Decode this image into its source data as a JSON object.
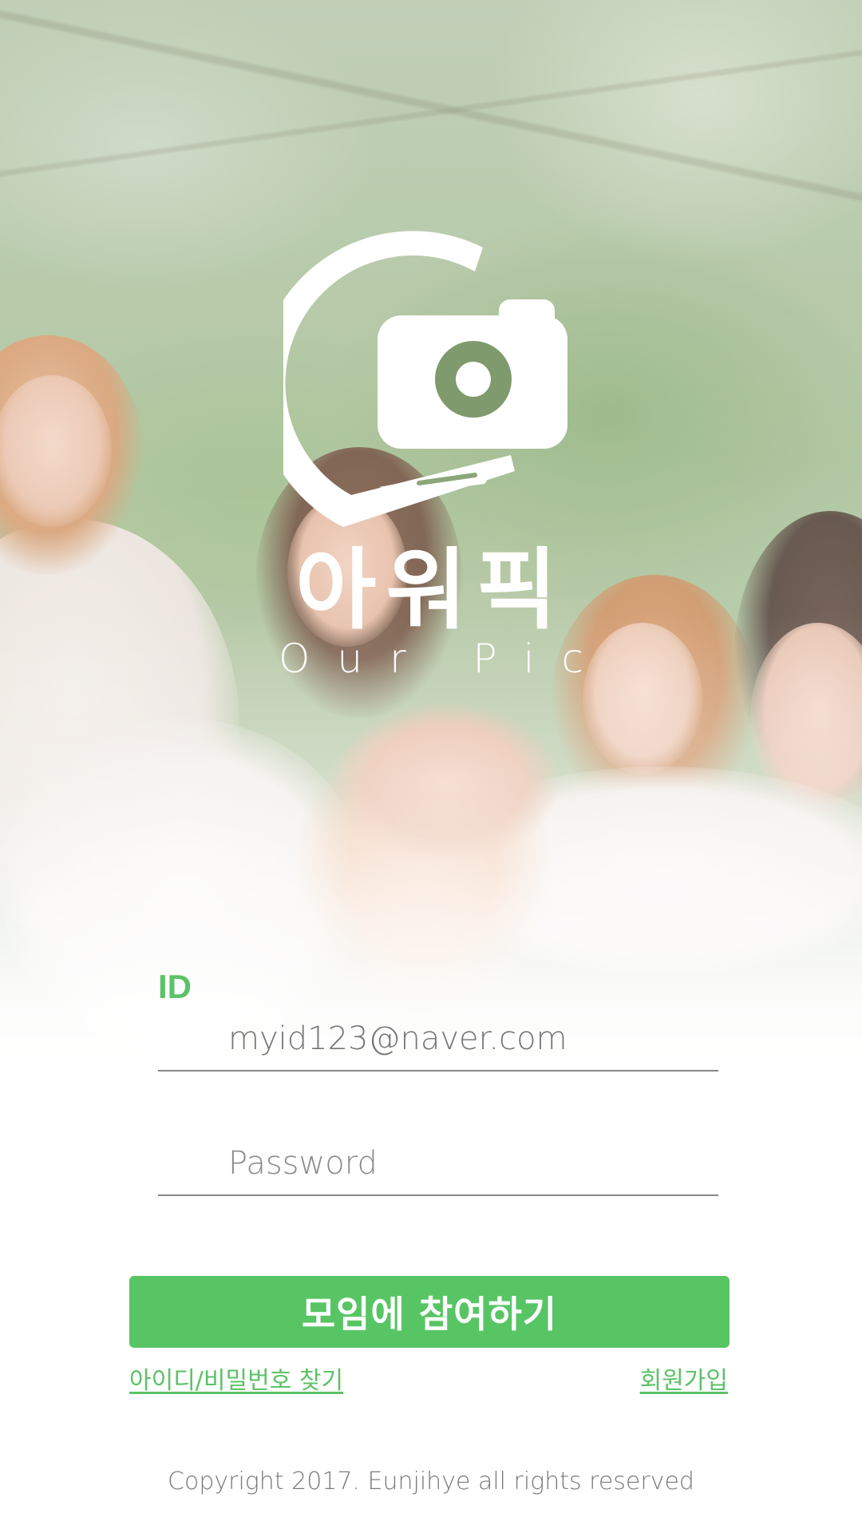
{
  "brand": {
    "name_korean": "아워픽",
    "name_english": "Our Pic",
    "logo_icon": "camera-hand-logo-icon"
  },
  "login": {
    "id_label": "ID",
    "id_value": "myid123@naver.com",
    "password_placeholder": "Password",
    "join_button": "모임에 참여하기",
    "find_account_link": "아이디/비밀번호 찾기",
    "signup_link": "회원가입"
  },
  "footer": {
    "copyright": "Copyright 2017. Eunjihye  all rights reserved"
  },
  "colors": {
    "accent": "#58c565",
    "label_green": "#5cc267",
    "text_gray": "#7a7a7a",
    "underline": "#888888"
  }
}
